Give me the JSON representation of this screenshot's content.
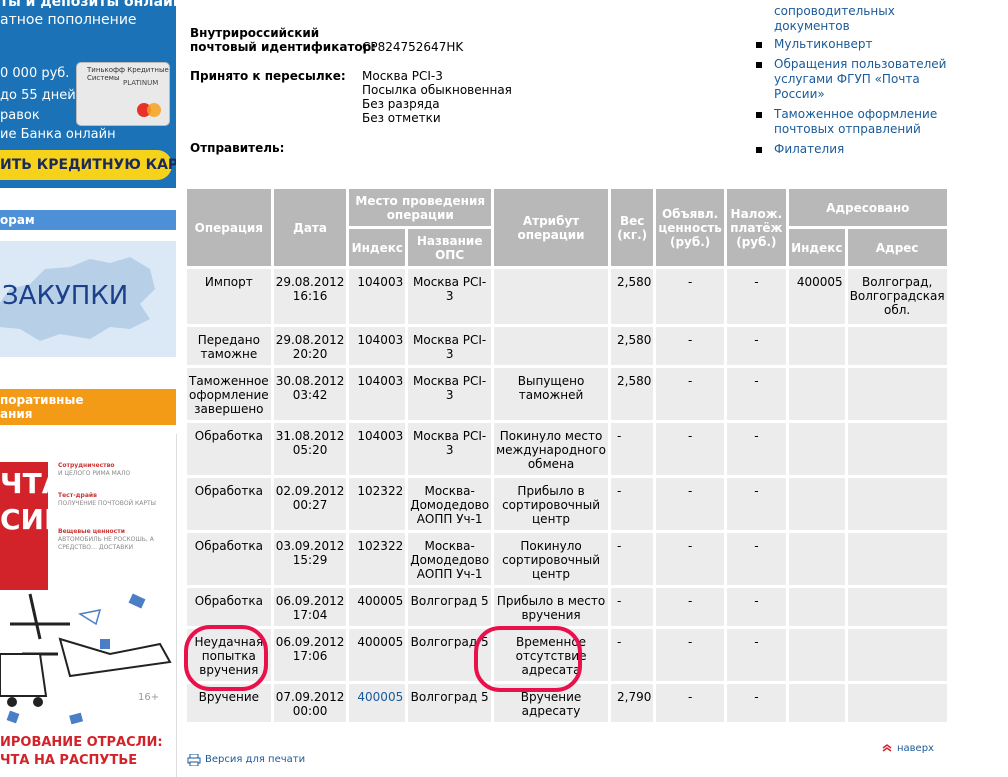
{
  "left": {
    "banner1": {
      "line1": "ты и депозиты онлайн",
      "line2": "атное пополнение",
      "lines": [
        "0 000 руб.",
        "до 55 дней",
        "равок",
        "ие Банка онлайн"
      ],
      "card_brand": "Тинькофф Кредитные Системы",
      "card_label": "PLATINUM",
      "button": "ИТЬ КРЕДИТНУЮ КАРТУ"
    },
    "banner2_head": "орам",
    "banner2_text": "ЗАКУПКИ",
    "banner3_head": [
      "поративные",
      "ания"
    ],
    "banner4": {
      "red_text": [
        "ЧТА",
        "СИИ"
      ],
      "blocks": [
        {
          "title": "Сотрудничество",
          "text": "И ЦЕЛОГО РИМА МАЛО"
        },
        {
          "title": "Тест-драйв",
          "text": "ПОЛУЧЕНИЕ ПОЧТОВОЙ КАРТЫ"
        },
        {
          "title": "Вещевые ценности",
          "text": "АВТОМОБИЛЬ НЕ РОСКОШЬ, А СРЕДСТВО… ДОСТАВКИ"
        }
      ],
      "age": "16+",
      "bottom": [
        "ИРОВАНИЕ ОТРАСЛИ:",
        "ЧТА НА РАСПУТЬЕ"
      ]
    }
  },
  "info": {
    "id_label_1": "Внутрироссийский",
    "id_label_2": "почтовый идентификатор:",
    "id_value": "CP824752647HK",
    "accepted_label": "Принято к пересылке:",
    "accepted_values": [
      "Москва PCI-3",
      "Посылка обыкновенная",
      "Без разряда",
      "Без отметки"
    ],
    "sender_label": "Отправитель:"
  },
  "right_menu": {
    "top_partial": [
      "сопроводительных",
      "документов"
    ],
    "items": [
      "Мультиконверт",
      "Обращения пользователей услугами ФГУП «Почта России»",
      "Таможенное оформление почтовых отправлений",
      "Филателия"
    ]
  },
  "table": {
    "headers": {
      "operation": "Операция",
      "date": "Дата",
      "place": "Место проведения операции",
      "index": "Индекс",
      "ops_name": "Название ОПС",
      "attribute": "Атрибут операции",
      "weight": "Вес (кг.)",
      "declared": "Объявл. ценность (руб.)",
      "cod": "Налож. платёж (руб.)",
      "addressed": "Адресовано",
      "addr_index": "Индекс",
      "address": "Адрес"
    },
    "rows": [
      {
        "op": "Импорт",
        "date": "29.08.2012 16:16",
        "idx": "104003",
        "ops": "Москва PCI-3",
        "attr": "",
        "w": "2,580",
        "val": "-",
        "cod": "-",
        "aidx": "400005",
        "addr": "Волгоград, Волгоградская обл."
      },
      {
        "op": "Передано таможне",
        "date": "29.08.2012 20:20",
        "idx": "104003",
        "ops": "Москва PCI-3",
        "attr": "",
        "w": "2,580",
        "val": "-",
        "cod": "-",
        "aidx": "",
        "addr": ""
      },
      {
        "op": "Таможенное оформление завершено",
        "date": "30.08.2012 03:42",
        "idx": "104003",
        "ops": "Москва PCI-3",
        "attr": "Выпущено таможней",
        "w": "2,580",
        "val": "-",
        "cod": "-",
        "aidx": "",
        "addr": ""
      },
      {
        "op": "Обработка",
        "date": "31.08.2012 05:20",
        "idx": "104003",
        "ops": "Москва PCI-3",
        "attr": "Покинуло место международного обмена",
        "w": "-",
        "val": "-",
        "cod": "-",
        "aidx": "",
        "addr": ""
      },
      {
        "op": "Обработка",
        "date": "02.09.2012 00:27",
        "idx": "102322",
        "ops": "Москва-Домодедово АОПП Уч-1",
        "attr": "Прибыло в сортировочный центр",
        "w": "-",
        "val": "-",
        "cod": "-",
        "aidx": "",
        "addr": ""
      },
      {
        "op": "Обработка",
        "date": "03.09.2012 15:29",
        "idx": "102322",
        "ops": "Москва-Домодедово АОПП Уч-1",
        "attr": "Покинуло сортировочный центр",
        "w": "-",
        "val": "-",
        "cod": "-",
        "aidx": "",
        "addr": ""
      },
      {
        "op": "Обработка",
        "date": "06.09.2012 17:04",
        "idx": "400005",
        "ops": "Волгоград 5",
        "attr": "Прибыло в место вручения",
        "w": "-",
        "val": "-",
        "cod": "-",
        "aidx": "",
        "addr": ""
      },
      {
        "op": "Неудачная попытка вручения",
        "date": "06.09.2012 17:06",
        "idx": "400005",
        "ops": "Волгоград 5",
        "attr": "Временное отсутствие адресата",
        "w": "-",
        "val": "-",
        "cod": "-",
        "aidx": "",
        "addr": ""
      },
      {
        "op": "Вручение",
        "date": "07.09.2012 00:00",
        "idx": "400005",
        "ops": "Волгоград 5",
        "attr": "Вручение адресату",
        "w": "2,790",
        "val": "-",
        "cod": "-",
        "aidx": "",
        "addr": ""
      }
    ],
    "row_heights": [
      55,
      38,
      52,
      52,
      52,
      52,
      38,
      52,
      38
    ]
  },
  "footer": {
    "print": "Версия для печати",
    "up": "наверх"
  }
}
